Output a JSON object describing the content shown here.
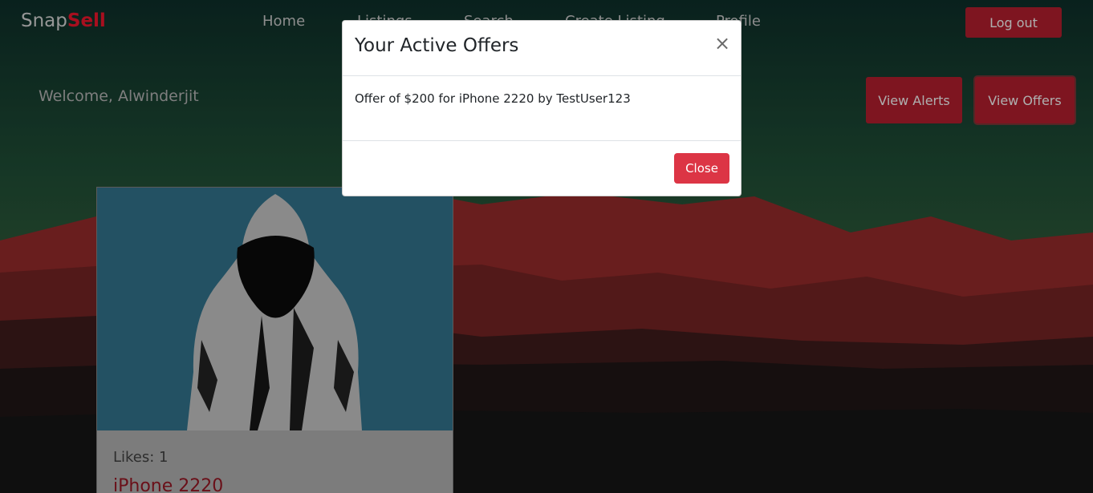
{
  "navbar": {
    "brand_primary": "Snap",
    "brand_accent": "Sell",
    "links": [
      "Home",
      "Listings",
      "Search",
      "Create Listing",
      "Profile"
    ],
    "logout_label": "Log out"
  },
  "dashboard": {
    "welcome": "Welcome, Alwinderjit",
    "view_alerts_label": "View Alerts",
    "view_offers_label": "View Offers"
  },
  "listing_card": {
    "likes": "Likes: 1",
    "title": "iPhone 2220"
  },
  "modal": {
    "title": "Your Active Offers",
    "close_symbol": "×",
    "offers": [
      "Offer of $200 for iPhone 2220 by TestUser123"
    ],
    "close_label": "Close"
  },
  "colors": {
    "brand_accent": "#e0142a",
    "button_red": "#a81d2b",
    "close_button": "#dc3545"
  },
  "icons": [
    "close-icon"
  ]
}
